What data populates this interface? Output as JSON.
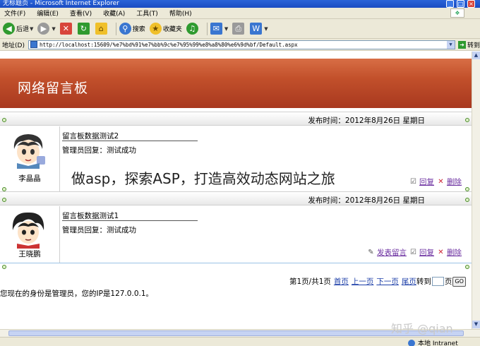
{
  "window": {
    "title": "无标题页 - Microsoft Internet Explorer",
    "controls": [
      "_",
      "□",
      "×"
    ]
  },
  "menu": [
    "文件(F)",
    "编辑(E)",
    "查看(V)",
    "收藏(A)",
    "工具(T)",
    "帮助(H)"
  ],
  "toolbar": {
    "back": "后退",
    "search": "搜索",
    "favorites": "收藏夹"
  },
  "address": {
    "label": "地址(D)",
    "url": "http://localhost:15609/%e7%bd%91%e7%bb%9c%e7%95%99%e8%a8%80%e6%9d%bf/Default.aspx",
    "go": "转到"
  },
  "page": {
    "banner_title": "网络留言板",
    "entries": [
      {
        "date": "发布时间：2012年8月26日  星期日",
        "title": "留言板数据测试2",
        "reply": "管理员回复：测试成功",
        "author": "李晶晶"
      },
      {
        "date": "发布时间：2012年8月26日  星期日",
        "title": "留言板数据测试1",
        "reply": "管理员回复：测试成功",
        "author": "王晓鹏",
        "actions": {
          "post": "发表留言",
          "reply": "回复",
          "delete": "删除"
        }
      }
    ],
    "first_entry_actions": {
      "reply": "回复",
      "delete": "删除"
    },
    "pager": {
      "info": "第1页/共1页",
      "first": "首页",
      "prev": "上一页",
      "next": "下一页",
      "last": "尾页",
      "goto": "转到",
      "page_suffix": "页",
      "go_button": "GO"
    },
    "user_line": "您现在的身份是管理员，您的IP是127.0.0.1。"
  },
  "status": {
    "zone": "本地 Intranet"
  },
  "overlay_caption": "做asp，探索ASP，打造高效动态网站之旅",
  "watermark": "知乎 @qian",
  "colors": {
    "banner": "#c2502b",
    "link": "#1d3fa8",
    "visited": "#6b2fa0"
  }
}
